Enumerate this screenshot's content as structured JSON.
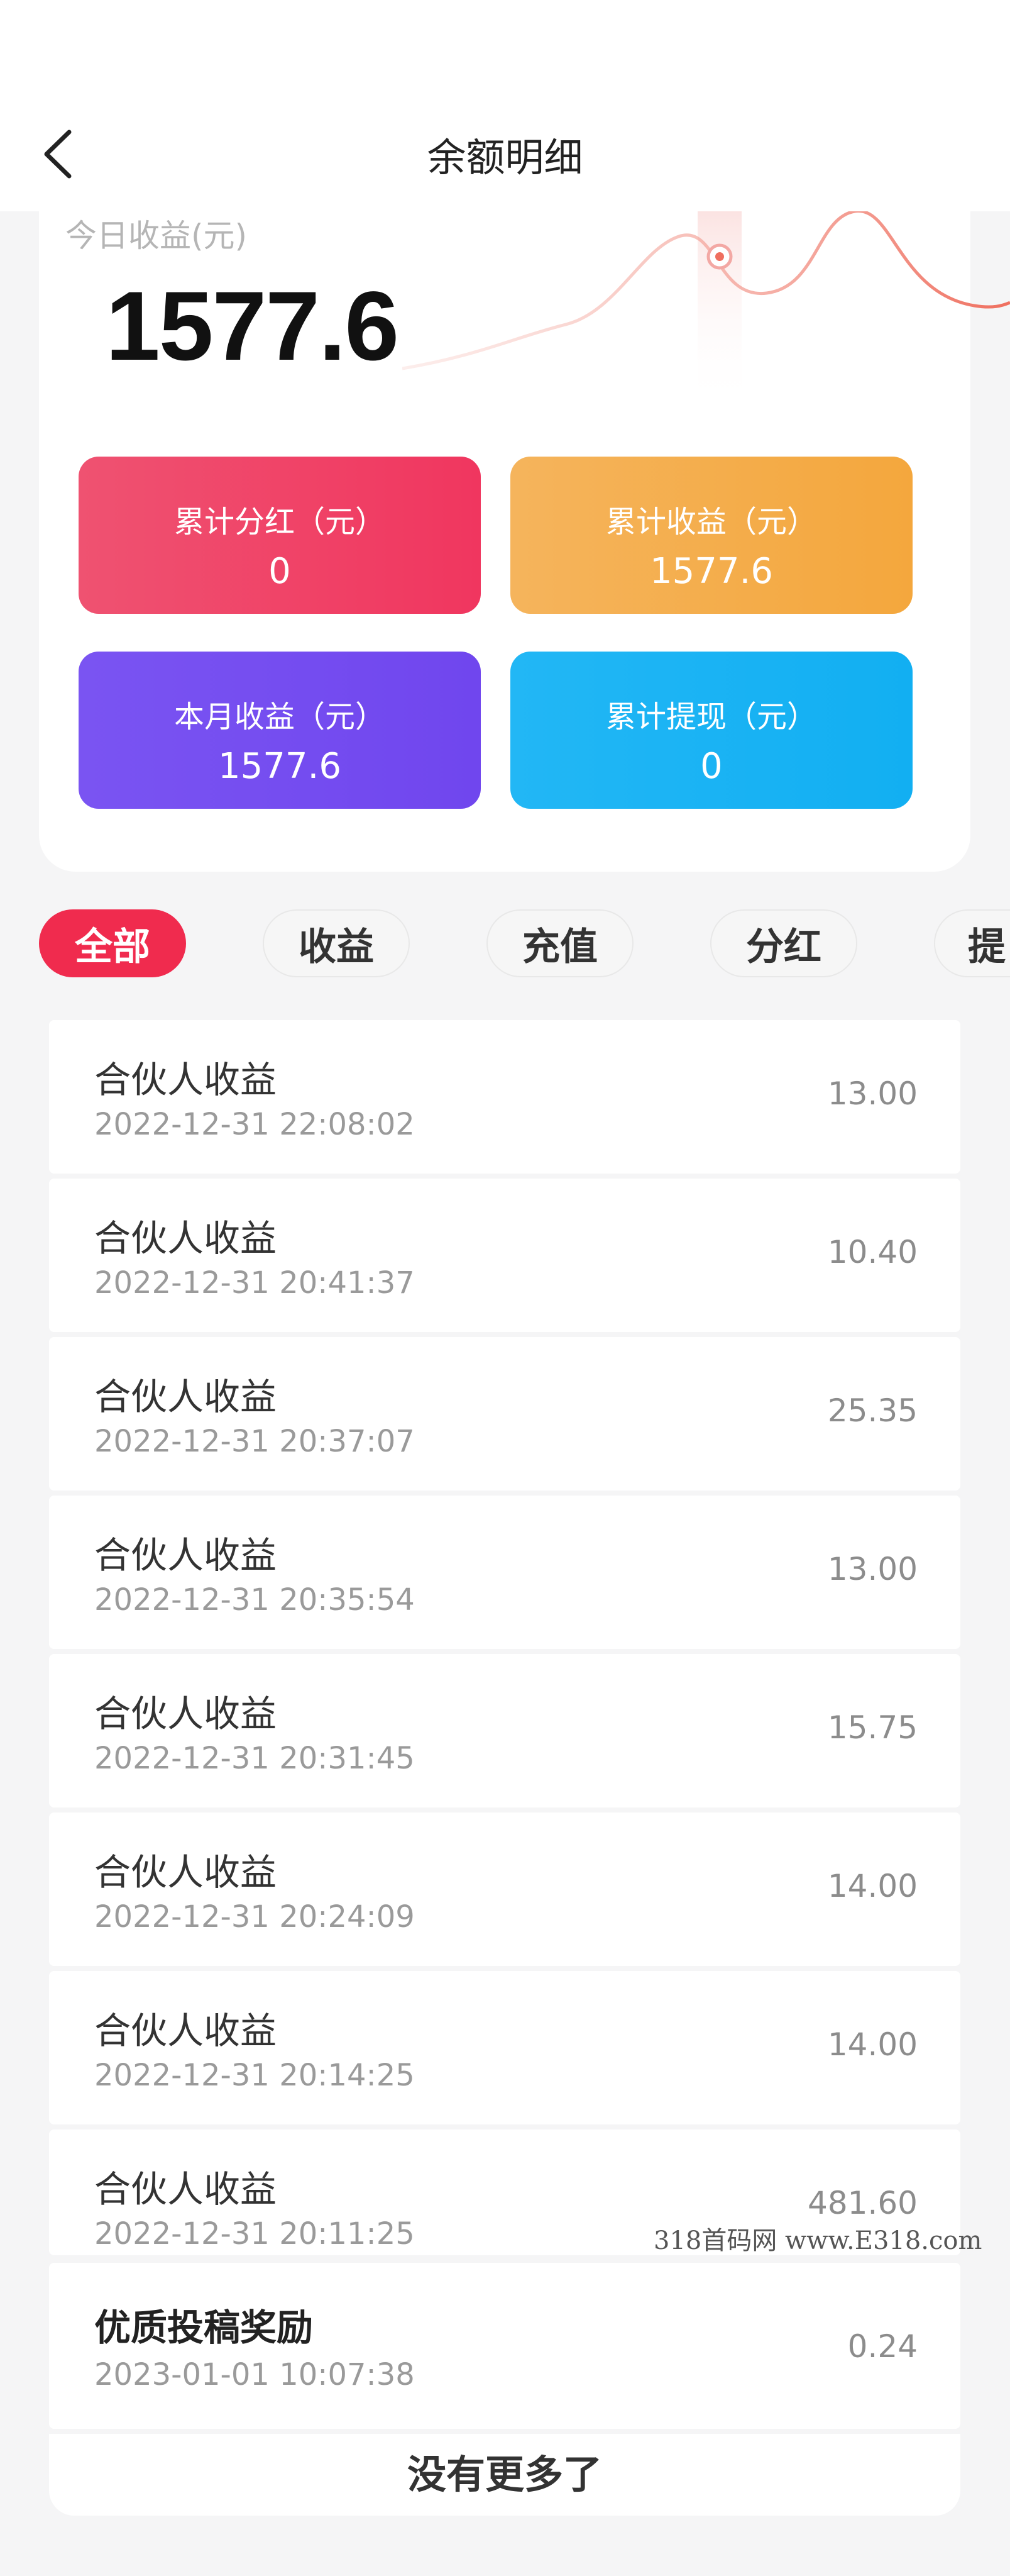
{
  "header": {
    "title": "余额明细",
    "back_icon": "chevron-left-icon"
  },
  "summary": {
    "today_label": "今日收益(元)",
    "today_value": "1577.6",
    "stats": [
      {
        "label": "累计分红（元）",
        "value": "0",
        "color": "#ef3f63"
      },
      {
        "label": "累计收益（元）",
        "value": "1577.6",
        "color": "#f4aa42"
      },
      {
        "label": "本月收益（元）",
        "value": "1577.6",
        "color": "#7549ef"
      },
      {
        "label": "累计提现（元）",
        "value": "0",
        "color": "#18b2f3"
      }
    ]
  },
  "tabs": [
    "全部",
    "收益",
    "充值",
    "分红",
    "提"
  ],
  "records": [
    {
      "name": "合伙人收益",
      "time": "2022-12-31 22:08:02",
      "amount": "13.00"
    },
    {
      "name": "合伙人收益",
      "time": "2022-12-31 20:41:37",
      "amount": "10.40"
    },
    {
      "name": "合伙人收益",
      "time": "2022-12-31 20:37:07",
      "amount": "25.35"
    },
    {
      "name": "合伙人收益",
      "time": "2022-12-31 20:35:54",
      "amount": "13.00"
    },
    {
      "name": "合伙人收益",
      "time": "2022-12-31 20:31:45",
      "amount": "15.75"
    },
    {
      "name": "合伙人收益",
      "time": "2022-12-31 20:24:09",
      "amount": "14.00"
    },
    {
      "name": "合伙人收益",
      "time": "2022-12-31 20:14:25",
      "amount": "14.00"
    },
    {
      "name": "合伙人收益",
      "time": "2022-12-31 20:11:25",
      "amount": "481.60"
    },
    {
      "name": "优质投稿奖励",
      "time": "2023-01-01 10:07:38",
      "amount": "0.24"
    }
  ],
  "footer": {
    "no_more": "没有更多了"
  },
  "watermark": "318首码网 www.E318.com"
}
